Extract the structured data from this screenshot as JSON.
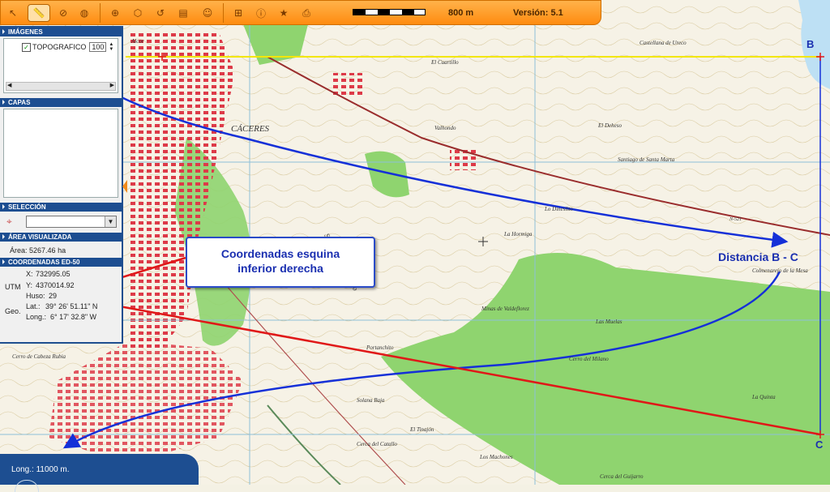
{
  "toolbar": {
    "icons": [
      "arrow-pointer-icon",
      "ruler-icon",
      "zoom-icon",
      "area-icon",
      "zoom-in-icon",
      "zoom-extent-icon",
      "zoom-prev-icon",
      "print-map-icon",
      "user-icon",
      "binoculars-icon",
      "info-icon",
      "star-icon",
      "printer-icon"
    ],
    "scale_label": "800 m",
    "version_label": "Versión: 5.1"
  },
  "panel": {
    "imagenes_title": "IMÁGENES",
    "layer_name": "TOPOGRAFICO",
    "layer_opacity": "100",
    "capas_title": "CAPAS",
    "seleccion_title": "SELECCIÓN",
    "area_title": "ÁREA VISUALIZADA",
    "area_label": "Área:",
    "area_value": "5267.46 ha",
    "coords_title": "COORDENADAS ED-50",
    "utm_label": "UTM",
    "x_label": "X:",
    "x_value": "732995.05",
    "y_label": "Y:",
    "y_value": "4370014.92",
    "huso_label": "Huso:",
    "huso_value": "29",
    "geo_label": "Geo.",
    "lat_label": "Lat.:",
    "lat_value": "39° 26' 51.11\" N",
    "long_label": "Long.:",
    "long_value": "6° 17' 32.8\" W"
  },
  "annotations": {
    "callout_line1": "Coordenadas esquina",
    "callout_line2": "inferior derecha",
    "distance_label": "Distancia B - C",
    "corner_b": "B",
    "corner_c": "C"
  },
  "status": {
    "longitud_text": "Long.: 11000 m."
  },
  "map_labels": [
    {
      "text": "CÁCERES",
      "size": 11
    },
    {
      "text": "El Cuartillo",
      "size": 7
    },
    {
      "text": "Valhondo",
      "size": 7
    },
    {
      "text": "El Deheso",
      "size": 7
    },
    {
      "text": "Castellana de Ureco",
      "size": 7
    },
    {
      "text": "Santiago de Santa Marta",
      "size": 7
    },
    {
      "text": "Lo Dineslito",
      "size": 7
    },
    {
      "text": "La Hormiga",
      "size": 7
    },
    {
      "text": "Minas de Valdeflorez",
      "size": 7
    },
    {
      "text": "Portanchito",
      "size": 7
    },
    {
      "text": "Solana Baja",
      "size": 7
    },
    {
      "text": "El Tinajón",
      "size": 7
    },
    {
      "text": "Cerca del Catallo",
      "size": 7
    },
    {
      "text": "Los Machones",
      "size": 7
    },
    {
      "text": "Cerca del Guijarro",
      "size": 7
    },
    {
      "text": "La Quinta",
      "size": 7
    },
    {
      "text": "Cerro del Milano",
      "size": 7
    },
    {
      "text": "Las Muelas",
      "size": 7
    },
    {
      "text": "Colmenarejo de la Mesa",
      "size": 7
    },
    {
      "text": "Sierra de Portanchito",
      "size": 9
    },
    {
      "text": "Cerro de Cabeza Rubia",
      "size": 7
    },
    {
      "text": "Alcor",
      "size": 7
    },
    {
      "text": "N-521",
      "size": 6
    }
  ],
  "colors": {
    "callout_blue": "#1a2fb0",
    "arrow_blue": "#1530d8",
    "arrow_red": "#e01818",
    "yellow_line": "#f2e600",
    "forest_green": "#8fd46f",
    "urban_red": "#d8404a",
    "panel_blue": "#1d4e91",
    "toolbar_orange": "#ff9a20"
  }
}
